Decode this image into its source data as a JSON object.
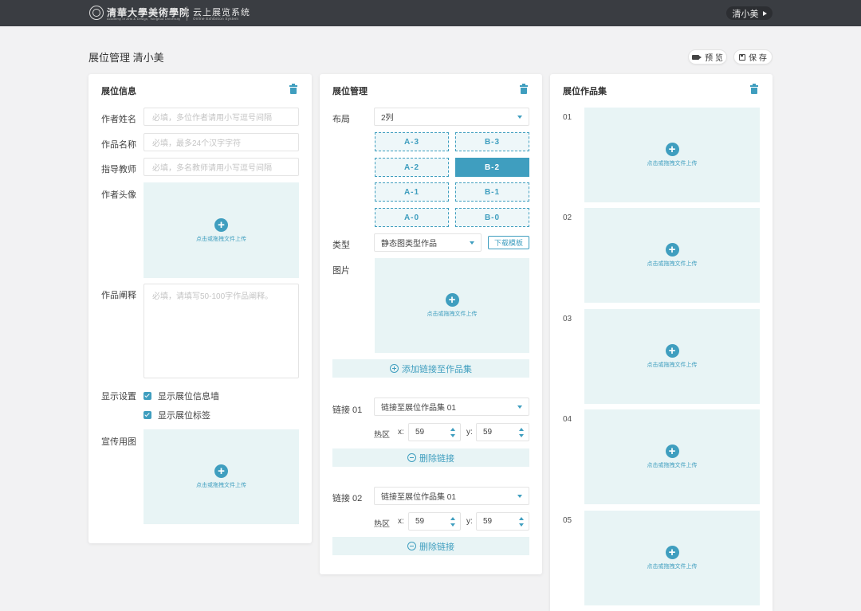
{
  "header": {
    "logo_main": "清華大學美術學院",
    "logo_sub": "Academy of Arts & Design, Tsinghua University",
    "system_name": "云上展览系统",
    "system_sub": "Online Exhibition System",
    "user": "清小美"
  },
  "page": {
    "title": "展位管理 清小美",
    "preview_label": "预 览",
    "save_label": "保 存"
  },
  "upload_hint": "点击或拖拽文件上传",
  "booth_info": {
    "title": "展位信息",
    "author_label": "作者姓名",
    "author_placeholder": "必填，多位作者请用小写逗号间隔",
    "work_label": "作品名称",
    "work_placeholder": "必填，最多24个汉字字符",
    "advisor_label": "指导教师",
    "advisor_placeholder": "必填，多名教师请用小写逗号间隔",
    "avatar_label": "作者头像",
    "desc_label": "作品阐释",
    "desc_placeholder": "必填，请填写50-100字作品阐释。",
    "display_label": "显示设置",
    "display_opt1": "显示展位信息墙",
    "display_opt2": "显示展位标签",
    "promo_label": "宣传用图"
  },
  "booth_manage": {
    "title": "展位管理",
    "layout_label": "布局",
    "layout_value": "2列",
    "slots": {
      "a3": "A-3",
      "b3": "B-3",
      "a2": "A-2",
      "b2": "B-2",
      "a1": "A-1",
      "b1": "B-1",
      "a0": "A-0",
      "b0": "B-0"
    },
    "active_slot": "B-2",
    "type_label": "类型",
    "type_value": "静态图类型作品",
    "download_template": "下载模板",
    "image_label": "图片",
    "add_link": "添加链接至作品集",
    "links": [
      {
        "label": "链接 01",
        "target": "链接至展位作品集 01",
        "hotzone": "热区",
        "x_label": "x:",
        "x": "59",
        "y_label": "y:",
        "y": "59",
        "delete": "删除链接"
      },
      {
        "label": "链接 02",
        "target": "链接至展位作品集 01",
        "hotzone": "热区",
        "x_label": "x:",
        "x": "59",
        "y_label": "y:",
        "y": "59",
        "delete": "删除链接"
      }
    ]
  },
  "collection": {
    "title": "展位作品集",
    "items": [
      "01",
      "02",
      "03",
      "04",
      "05"
    ]
  },
  "colors": {
    "accent": "#3f9ebf",
    "upload_bg": "#e8f4f5",
    "topbar": "#3a3d42"
  }
}
